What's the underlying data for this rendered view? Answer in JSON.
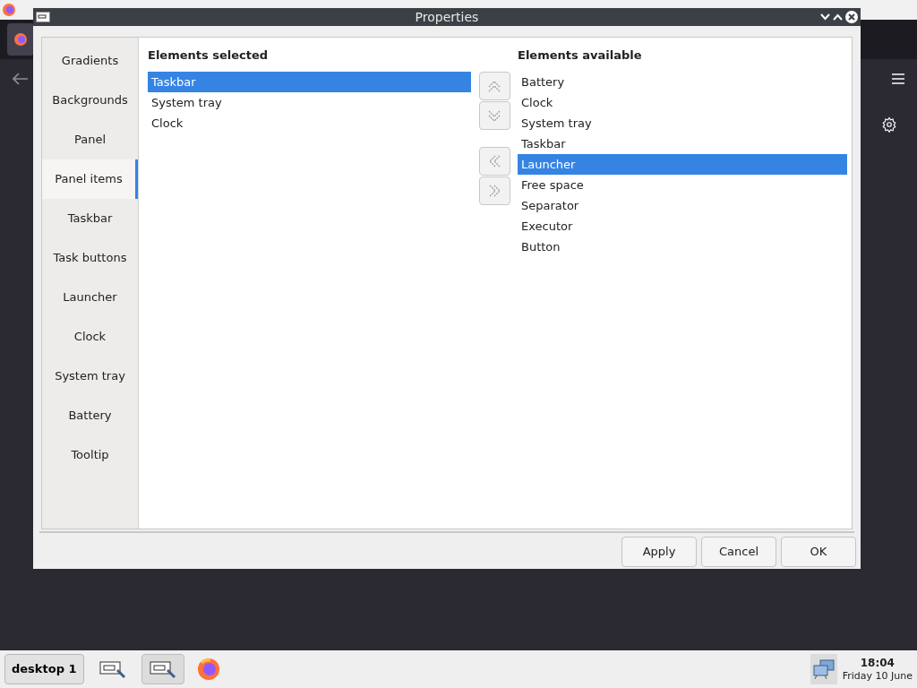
{
  "dialog": {
    "title": "Properties"
  },
  "sidebar": {
    "items": [
      {
        "label": "Gradients",
        "selected": false
      },
      {
        "label": "Backgrounds",
        "selected": false
      },
      {
        "label": "Panel",
        "selected": false
      },
      {
        "label": "Panel items",
        "selected": true
      },
      {
        "label": "Taskbar",
        "selected": false
      },
      {
        "label": "Task buttons",
        "selected": false
      },
      {
        "label": "Launcher",
        "selected": false
      },
      {
        "label": "Clock",
        "selected": false
      },
      {
        "label": "System tray",
        "selected": false
      },
      {
        "label": "Battery",
        "selected": false
      },
      {
        "label": "Tooltip",
        "selected": false
      }
    ]
  },
  "selected_list": {
    "heading": "Elements selected",
    "items": [
      {
        "label": "Taskbar",
        "selected": true
      },
      {
        "label": "System tray",
        "selected": false
      },
      {
        "label": "Clock",
        "selected": false
      }
    ]
  },
  "available_list": {
    "heading": "Elements available",
    "items": [
      {
        "label": "Battery",
        "selected": false
      },
      {
        "label": "Clock",
        "selected": false
      },
      {
        "label": "System tray",
        "selected": false
      },
      {
        "label": "Taskbar",
        "selected": false
      },
      {
        "label": "Launcher",
        "selected": true
      },
      {
        "label": "Free space",
        "selected": false
      },
      {
        "label": "Separator",
        "selected": false
      },
      {
        "label": "Executor",
        "selected": false
      },
      {
        "label": "Button",
        "selected": false
      }
    ]
  },
  "buttons": [
    "Apply",
    "Cancel",
    "OK"
  ],
  "taskbar": {
    "desktop": "desktop 1",
    "tasks": [
      {
        "selected": false
      },
      {
        "selected": true
      }
    ],
    "time": "18:04",
    "date": "Friday 10 June"
  }
}
